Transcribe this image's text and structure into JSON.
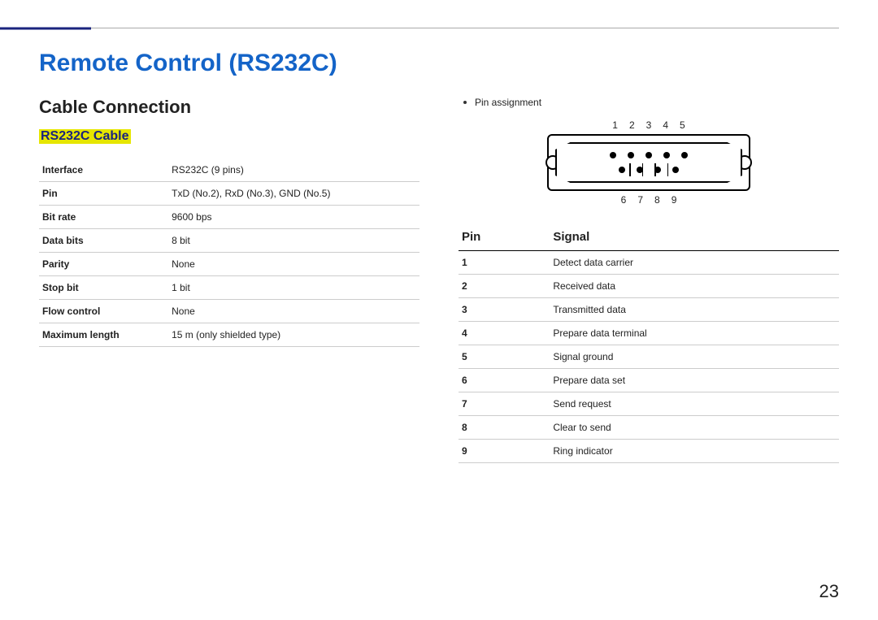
{
  "page_title": "Remote Control (RS232C)",
  "section_title": "Cable Connection",
  "sub_title": "RS232C Cable",
  "spec_table": [
    {
      "k": "Interface",
      "v": "RS232C (9 pins)"
    },
    {
      "k": "Pin",
      "v": "TxD (No.2), RxD (No.3), GND (No.5)"
    },
    {
      "k": "Bit rate",
      "v": "9600 bps"
    },
    {
      "k": "Data bits",
      "v": "8 bit"
    },
    {
      "k": "Parity",
      "v": "None"
    },
    {
      "k": "Stop bit",
      "v": "1 bit"
    },
    {
      "k": "Flow control",
      "v": "None"
    },
    {
      "k": "Maximum length",
      "v": "15 m (only shielded type)"
    }
  ],
  "pin_assignment_label": "Pin assignment",
  "top_pins": [
    "1",
    "2",
    "3",
    "4",
    "5"
  ],
  "bottom_pins": [
    "6",
    "7",
    "8",
    "9"
  ],
  "pin_table_headers": {
    "pin": "Pin",
    "signal": "Signal"
  },
  "pin_table": [
    {
      "pin": "1",
      "signal": "Detect data carrier"
    },
    {
      "pin": "2",
      "signal": "Received data"
    },
    {
      "pin": "3",
      "signal": "Transmitted data"
    },
    {
      "pin": "4",
      "signal": "Prepare data terminal"
    },
    {
      "pin": "5",
      "signal": "Signal ground"
    },
    {
      "pin": "6",
      "signal": "Prepare data set"
    },
    {
      "pin": "7",
      "signal": "Send request"
    },
    {
      "pin": "8",
      "signal": "Clear to send"
    },
    {
      "pin": "9",
      "signal": "Ring indicator"
    }
  ],
  "page_number": "23"
}
